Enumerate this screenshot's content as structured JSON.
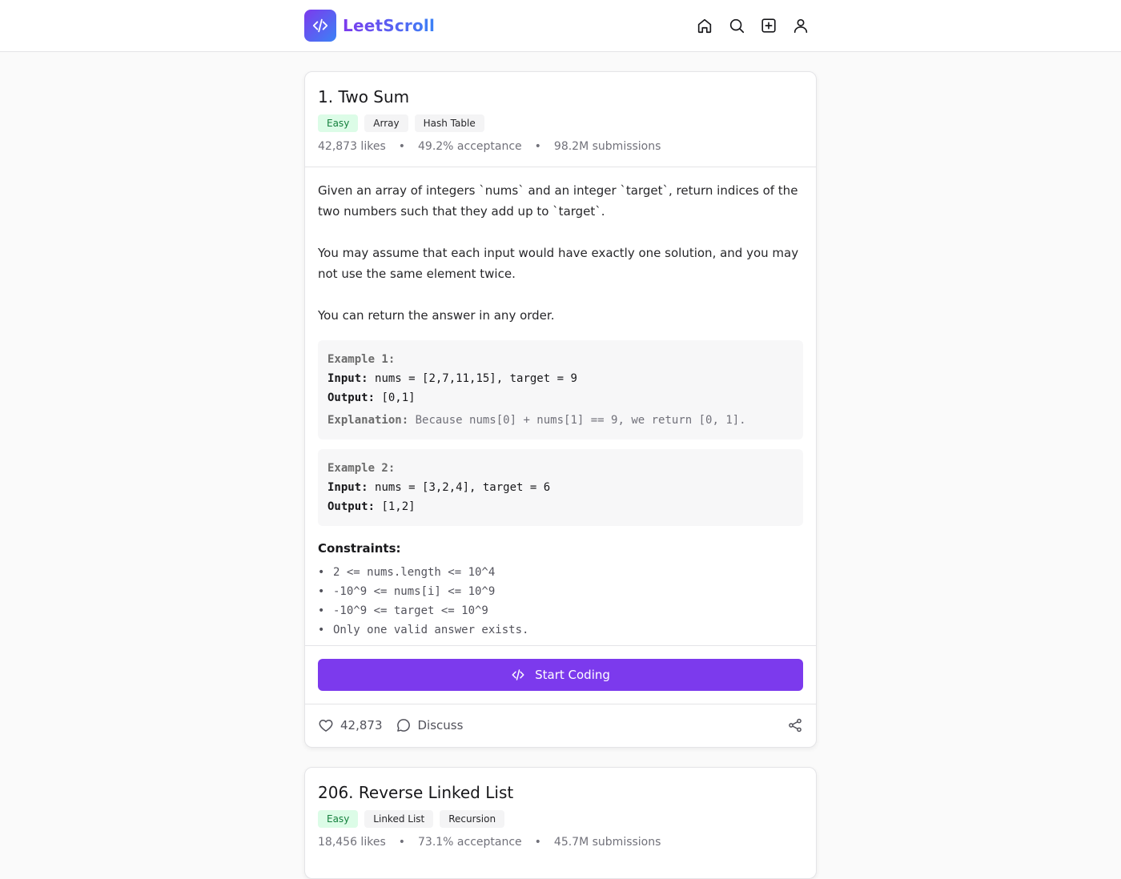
{
  "app": {
    "name": "LeetScroll"
  },
  "nav": {
    "home": "home-icon",
    "search": "search-icon",
    "create": "plus-square-icon",
    "profile": "user-icon"
  },
  "colors": {
    "accent": "#7c3aed",
    "easy_bg": "#dcfce7",
    "easy_text": "#15803d"
  },
  "problems": [
    {
      "title": "1. Two Sum",
      "tags": [
        "Easy",
        "Array",
        "Hash Table"
      ],
      "stats": {
        "likes": "42,873 likes",
        "acceptance": "49.2% acceptance",
        "submissions": "98.2M submissions",
        "sep": "•"
      },
      "description": [
        "Given an array of integers `nums` and an integer `target`, return indices of the two numbers such that they add up to `target`.",
        "You may assume that each input would have exactly one solution, and you may not use the same element twice.",
        "You can return the answer in any order."
      ],
      "examples": [
        {
          "title": "Example 1:",
          "input_label": "Input:",
          "input": "nums = [2,7,11,15], target = 9",
          "output_label": "Output:",
          "output": "[0,1]",
          "explanation_label": "Explanation:",
          "explanation": "Because nums[0] + nums[1] == 9, we return [0, 1]."
        },
        {
          "title": "Example 2:",
          "input_label": "Input:",
          "input": "nums = [3,2,4], target = 6",
          "output_label": "Output:",
          "output": "[1,2]"
        }
      ],
      "constraints_title": "Constraints:",
      "constraints": [
        "2 <= nums.length <= 10^4",
        "-10^9 <= nums[i] <= 10^9",
        "-10^9 <= target <= 10^9",
        "Only one valid answer exists."
      ],
      "start_label": "Start Coding",
      "like_count": "42,873",
      "discuss_label": "Discuss"
    },
    {
      "title": "206. Reverse Linked List",
      "tags": [
        "Easy",
        "Linked List",
        "Recursion"
      ],
      "stats": {
        "likes": "18,456 likes",
        "acceptance": "73.1% acceptance",
        "submissions": "45.7M submissions",
        "sep": "•"
      }
    }
  ]
}
